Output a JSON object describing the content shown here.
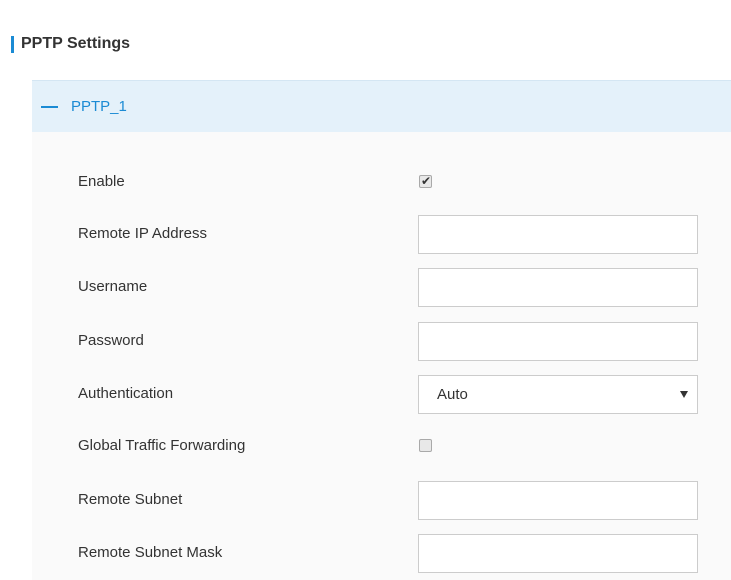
{
  "section": {
    "title": "PPTP Settings"
  },
  "panel": {
    "title": "PPTP_1",
    "fields": {
      "enable": {
        "label": "Enable",
        "checked": true
      },
      "remote_ip": {
        "label": "Remote IP Address",
        "value": ""
      },
      "username": {
        "label": "Username",
        "value": ""
      },
      "password": {
        "label": "Password",
        "value": ""
      },
      "authentication": {
        "label": "Authentication",
        "selected": "Auto"
      },
      "global_traffic_forwarding": {
        "label": "Global Traffic Forwarding",
        "checked": false
      },
      "remote_subnet": {
        "label": "Remote Subnet",
        "value": ""
      },
      "remote_subnet_mask": {
        "label": "Remote Subnet Mask",
        "value": ""
      }
    }
  },
  "icons": {
    "check": "✔"
  },
  "colors": {
    "accent": "#1b8bd4",
    "header_bg": "#e4f1fa",
    "panel_bg": "#fafafa"
  }
}
